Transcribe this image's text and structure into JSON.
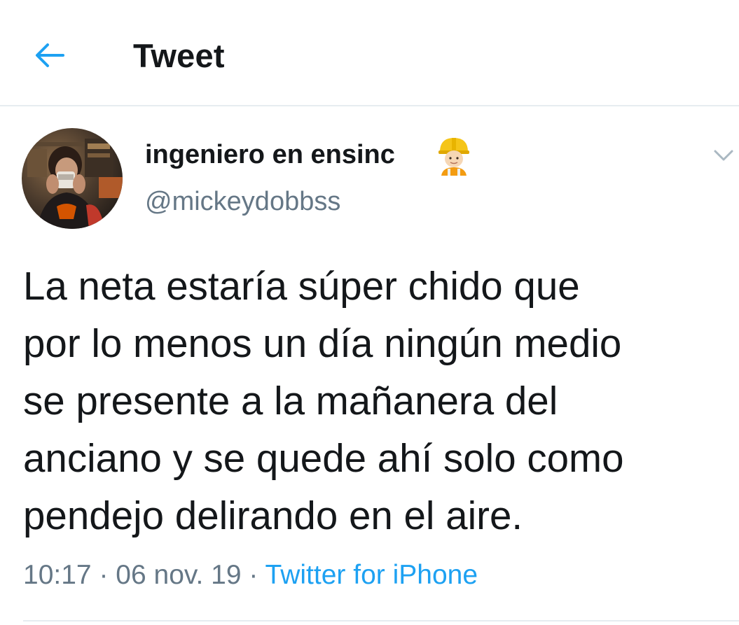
{
  "header": {
    "title": "Tweet",
    "back_icon": "arrow-left-icon"
  },
  "tweet": {
    "author": {
      "display_name": "ingeniero en ensinc",
      "handle": "@mickeydobbss",
      "avatar_icon": "avatar-photo",
      "name_emoji": "construction-worker-emoji"
    },
    "text": "La neta estaría súper chido que\npor lo menos un día ningún medio\nse presente a la mañanera del\nanciano y se quede ahí solo como\npendejo delirando en el aire.",
    "time": "10:17",
    "date": "06 nov. 19",
    "separator": "·",
    "source": "Twitter for iPhone"
  },
  "colors": {
    "accent": "#1da1f2",
    "text": "#14171a",
    "secondary_text": "#657786",
    "divider": "#e6ecf0",
    "chevron": "#aab8c2"
  }
}
